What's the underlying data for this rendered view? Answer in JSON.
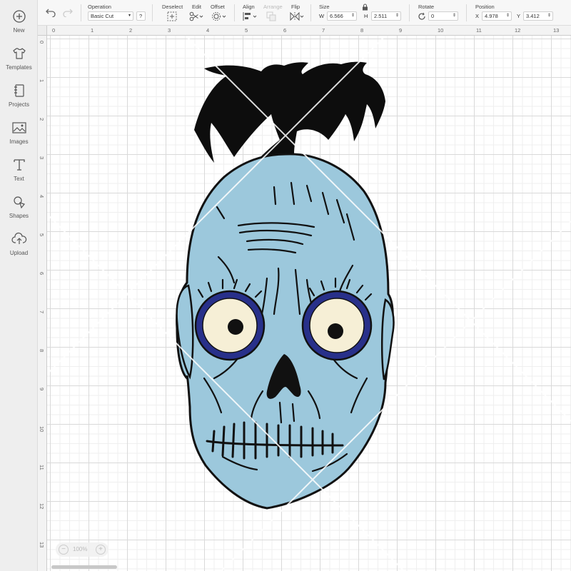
{
  "sidebar": {
    "items": [
      {
        "label": "New",
        "icon": "plus-circle-icon"
      },
      {
        "label": "Templates",
        "icon": "tshirt-icon"
      },
      {
        "label": "Projects",
        "icon": "notebook-icon"
      },
      {
        "label": "Images",
        "icon": "image-icon"
      },
      {
        "label": "Text",
        "icon": "text-t-icon"
      },
      {
        "label": "Shapes",
        "icon": "shapes-icon"
      },
      {
        "label": "Upload",
        "icon": "cloud-upload-icon"
      }
    ]
  },
  "toolbar": {
    "operation_label": "Operation",
    "operation_value": "Basic Cut",
    "help": "?",
    "deselect_label": "Deselect",
    "edit_label": "Edit",
    "offset_label": "Offset",
    "align_label": "Align",
    "arrange_label": "Arrange",
    "flip_label": "Flip",
    "size_label": "Size",
    "width_prefix": "W",
    "width_value": "6.566",
    "height_prefix": "H",
    "height_value": "2.511",
    "rotate_label": "Rotate",
    "rotate_value": "0",
    "position_label": "Position",
    "x_prefix": "X",
    "x_value": "4.978",
    "y_prefix": "Y",
    "y_value": "3.412"
  },
  "rulers": {
    "top": [
      "0",
      "1",
      "2",
      "3",
      "4",
      "5",
      "6",
      "7",
      "8",
      "9",
      "10",
      "11",
      "12",
      "13"
    ],
    "left": [
      "0",
      "1",
      "2",
      "3",
      "4",
      "5",
      "6",
      "7",
      "8",
      "9",
      "10",
      "11",
      "12",
      "13"
    ]
  },
  "zoom": {
    "minus": "−",
    "value": "100%",
    "plus": "+"
  },
  "colors": {
    "skin": "#9cc8dc",
    "outline": "#111111",
    "hair": "#0d0d0d",
    "eye_white": "#f6efd6",
    "iris_ring": "#28308a",
    "watermark": "#ffffff"
  }
}
